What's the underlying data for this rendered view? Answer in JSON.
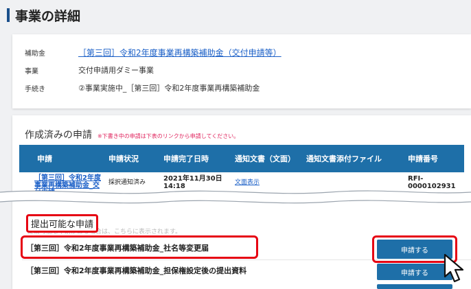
{
  "page": {
    "title": "事業の詳細"
  },
  "info": {
    "subsidy_label": "補助金",
    "subsidy_value": "［第三回］令和2年度事業再構築補助金（交付申請等）",
    "business_label": "事業",
    "business_value": "交付申請用ダミー事業",
    "procedure_label": "手続き",
    "procedure_value": "②事業実施中_［第三回］令和2年度事業再構築補助金"
  },
  "created": {
    "title": "作成済みの申請",
    "note": "※下書き中の申請は下表のリンクから申請してください。",
    "columns": [
      "申請",
      "申請状況",
      "申請完了日時",
      "通知文書（文面）",
      "通知文書添付ファイル",
      "申請番号"
    ],
    "row": {
      "application_line1": "［第三回］令和2年度",
      "application_line2": "事業再構築補助金_交",
      "application_line3": "付申請",
      "status": "採択通知済み",
      "datetime_line1": "2021年11月30日",
      "datetime_line2": "14:18",
      "notice_link": "文面表示",
      "number_line1": "RFI-",
      "number_line2": "0000102931"
    }
  },
  "available": {
    "title": "提出可能な申請",
    "subtitle": "提出可能な申請がある場合は、こちらに表示されます。",
    "items": [
      {
        "name": "［第三回］令和2年度事業再構築補助金_社名等変更届",
        "button": "申請する"
      },
      {
        "name": "［第三回］令和2年度事業再構築補助金_担保権設定後の提出資料",
        "button": "申請する"
      }
    ]
  },
  "colors": {
    "accent": "#1e6fa8",
    "highlight": "#e60012",
    "link": "#1a5fc7",
    "note": "#e0245e"
  }
}
